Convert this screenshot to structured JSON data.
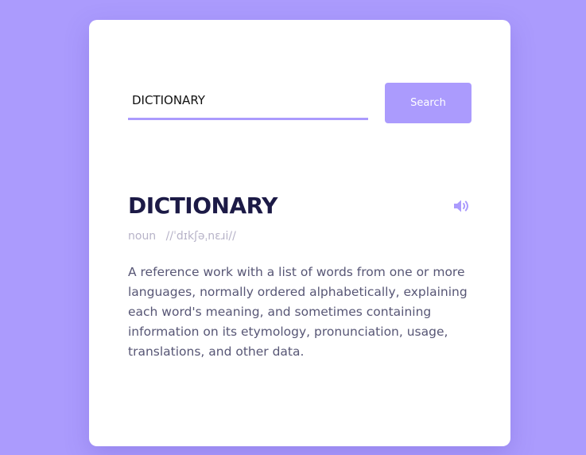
{
  "search": {
    "value": "DICTIONARY",
    "placeholder": "",
    "button_label": "Search"
  },
  "result": {
    "word": "DICTIONARY",
    "part_of_speech": "noun",
    "phonetic": "//ˈdɪkʃəˌnɛɹi//",
    "definition": "A reference work with a list of words from one or more languages, normally ordered alphabetically, explaining each word's meaning, and sometimes containing information on its etymology, pronunciation, usage, translations, and other data."
  },
  "icons": {
    "sound": "speaker-volume-icon"
  },
  "colors": {
    "background": "#ab9bfd",
    "accent": "#ab9bfd",
    "card": "#ffffff",
    "word": "#1c1a46",
    "details": "#b7b3c8",
    "definition": "#575675"
  }
}
